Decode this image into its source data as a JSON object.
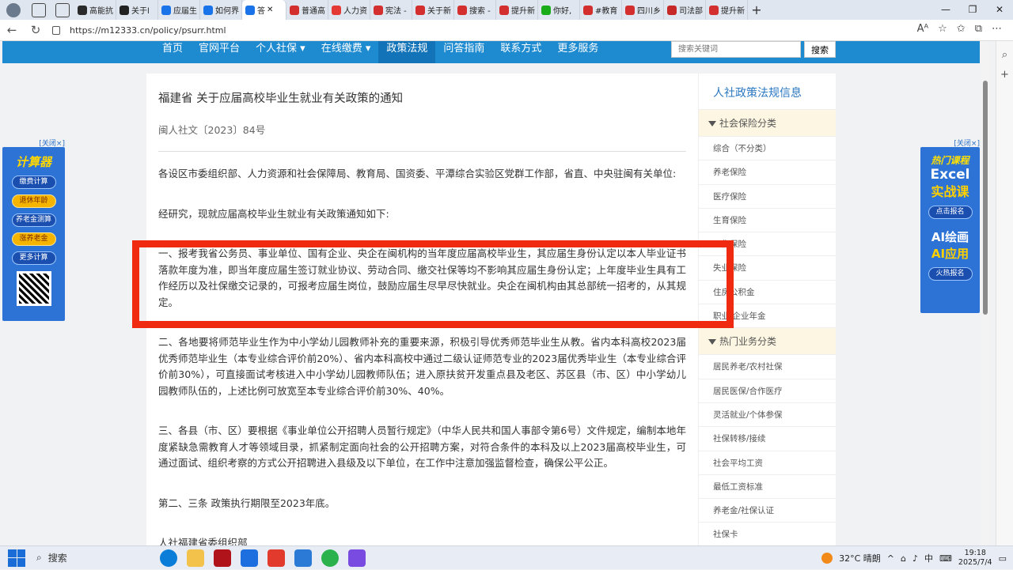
{
  "browser": {
    "tabs": [
      "高能抗",
      "关于l",
      "应届生",
      "如何界",
      "答",
      "普通高",
      "人力资",
      "宪法 -",
      "关于新",
      "搜索 -",
      "提升新",
      "你好,",
      "#教育",
      "四川乡",
      "司法部",
      "提升新"
    ],
    "active_tab_index": 4,
    "url": "https://m12333.cn/policy/psurr.html"
  },
  "nav": {
    "items": [
      "首页",
      "官网平台",
      "个人社保 ▾",
      "在线缴费 ▾",
      "政策法规",
      "问答指南",
      "联系方式",
      "更多服务"
    ],
    "active_index": 4,
    "search_placeholder": "搜索关键词",
    "search_button": "搜索"
  },
  "article": {
    "title": "福建省 关于应届高校毕业生就业有关政策的通知",
    "doc_number": "闽人社文〔2023〕84号",
    "paragraphs": [
      "各设区市委组织部、人力资源和社会保障局、教育局、国资委、平潭综合实验区党群工作部，省直、中央驻闽有关单位:",
      "经研究，现就应届高校毕业生就业有关政策通知如下:",
      "一、报考我省公务员、事业单位、国有企业、央企在闽机构的当年度应届高校毕业生，其应届生身份认定以本人毕业证书落款年度为准，即当年度应届生签订就业协议、劳动合同、缴交社保等均不影响其应届生身份认定；上年度毕业生具有工作经历以及社保缴交记录的，可报考应届生岗位，鼓励应届生尽早尽快就业。央企在闽机构由其总部统一招考的，从其规定。",
      "二、各地要将师范毕业生作为中小学幼儿园教师补充的重要来源，积极引导优秀师范毕业生从教。省内本科高校2023届优秀师范毕业生（本专业综合评价前20%）、省内本科高校中通过二级认证师范专业的2023届优秀毕业生（本专业综合评价前30%），可直接面试考核进入中小学幼儿园教师队伍；进入原扶贫开发重点县及老区、苏区县（市、区）中小学幼儿园教师队伍的，上述比例可放宽至本专业综合评价前30%、40%。",
      "三、各县（市、区）要根据《事业单位公开招聘人员暂行规定》（中华人民共和国人事部令第6号）文件规定，编制本地年度紧缺急需教育人才等领域目录，抓紧制定面向社会的公开招聘方案，对符合条件的本科及以上2023届高校毕业生，可通过面试、组织考察的方式公开招聘进入县级及以下单位，在工作中注意加强监督检查，确保公平公正。",
      "第二、三条 政策执行期限至2023年底。",
      "人社福建省委组织部"
    ]
  },
  "sidebar": {
    "heading": "人社政策法规信息",
    "category1": "社会保险分类",
    "items1": [
      "综合（不分类）",
      "养老保险",
      "医疗保险",
      "生育保险",
      "工伤保险",
      "失业保险",
      "住房公积金",
      "职业/企业年金"
    ],
    "category2": "热门业务分类",
    "items2": [
      "居民养老/农村社保",
      "居民医保/合作医疗",
      "灵活就业/个体参保",
      "社保转移/接续",
      "社会平均工资",
      "最低工资标准",
      "养老金/社保认证",
      "社保卡"
    ]
  },
  "ad_left": {
    "close": "[关闭×]",
    "title": "计算器",
    "buttons": [
      "缴费计算",
      "退休年龄",
      "养老金测算",
      "涨养老金",
      "更多计算"
    ]
  },
  "ad_right": {
    "close": "[关闭×]",
    "line1": "热门课程",
    "line2": "Excel",
    "line3": "实战课",
    "btn1": "点击报名",
    "line4": "AI绘画",
    "line5": "AI应用",
    "btn2": "火热报名"
  },
  "taskbar": {
    "search": "搜索",
    "weather": "32°C 晴朗",
    "ime": "中",
    "time": "19:18",
    "date": "2025/7/4"
  }
}
